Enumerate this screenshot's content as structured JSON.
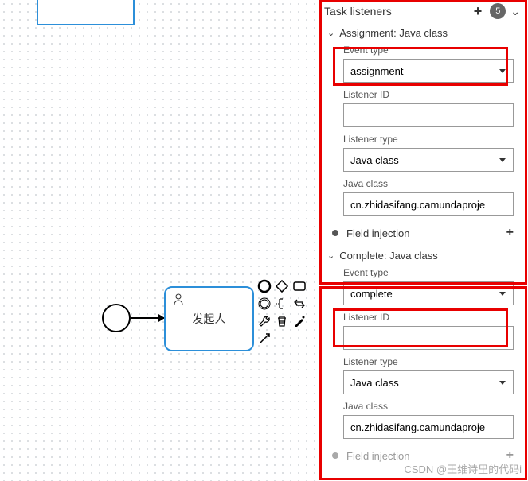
{
  "canvas": {
    "task_label": "发起人"
  },
  "panel": {
    "header": {
      "title": "Task listeners",
      "badge": "5"
    },
    "listener1": {
      "title": "Assignment: Java class",
      "event_type_label": "Event type",
      "event_type_value": "assignment",
      "listener_id_label": "Listener ID",
      "listener_id_value": "",
      "listener_type_label": "Listener type",
      "listener_type_value": "Java class",
      "java_class_label": "Java class",
      "java_class_value": "cn.zhidasifang.camundaproje",
      "field_injection": "Field injection"
    },
    "listener2": {
      "title": "Complete: Java class",
      "event_type_label": "Event type",
      "event_type_value": "complete",
      "listener_id_label": "Listener ID",
      "listener_id_value": "",
      "listener_type_label": "Listener type",
      "listener_type_value": "Java class",
      "java_class_label": "Java class",
      "java_class_value": "cn.zhidasifang.camundaproje",
      "field_injection": "Field injection"
    }
  },
  "watermark": "CSDN @王维诗里的代码i"
}
